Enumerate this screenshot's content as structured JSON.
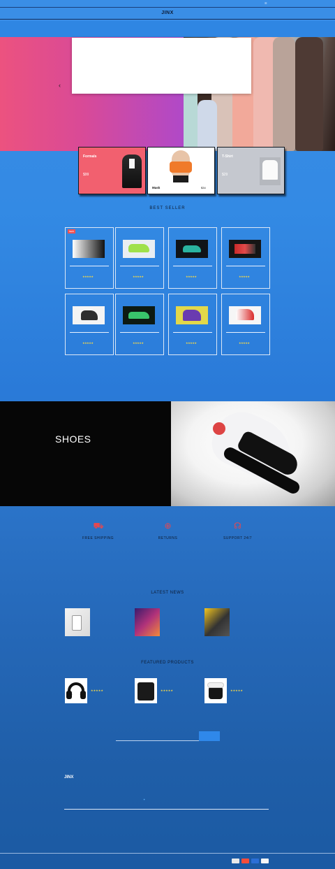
{
  "topbar": {
    "left": "",
    "links": [
      "",
      ""
    ]
  },
  "brand": {
    "logo": "JINX"
  },
  "nav": {
    "items": [
      "",
      "",
      "",
      "",
      "",
      ""
    ]
  },
  "mega_menu": {
    "columns": [
      {
        "heading": "",
        "items": [
          "",
          "",
          "",
          "",
          ""
        ]
      },
      {
        "heading": "",
        "items": [
          "",
          "",
          ""
        ]
      },
      {
        "heading": "",
        "items": [
          "",
          "",
          "",
          "",
          ""
        ]
      },
      {
        "heading": "",
        "items": [
          "",
          ""
        ]
      },
      {
        "heading": "",
        "items": [
          "",
          "",
          ""
        ]
      }
    ]
  },
  "hero": {
    "button": ""
  },
  "categories": [
    {
      "title": "Formals",
      "desc": "",
      "price": "$99",
      "color": "#f2606f"
    },
    {
      "title": "Mask",
      "desc": "",
      "price": "$34",
      "color": "#ffffff"
    },
    {
      "title": "T-Shirt",
      "desc": "",
      "price": "$29",
      "color": "#c5c8cf"
    }
  ],
  "best_seller": {
    "title": "BEST SELLER",
    "tabs": [
      "",
      "",
      "",
      "",
      "",
      "",
      ""
    ],
    "products": [
      {
        "badge": "NEW",
        "stars": "★★★★★",
        "price": "",
        "old": ""
      },
      {
        "badge": "",
        "stars": "★★★★★",
        "price": "",
        "old": ""
      },
      {
        "badge": "",
        "stars": "★★★★★",
        "price": "",
        "old": ""
      },
      {
        "badge": "",
        "stars": "★★★★★",
        "price": "",
        "old": ""
      },
      {
        "badge": "",
        "stars": "★★★★★",
        "price": "",
        "old": ""
      },
      {
        "badge": "",
        "stars": "★★★★★",
        "price": "",
        "old": ""
      },
      {
        "badge": "",
        "stars": "★★★★★",
        "price": "",
        "old": ""
      },
      {
        "badge": "",
        "stars": "★★★★★",
        "price": "",
        "old": ""
      }
    ],
    "load_more": ""
  },
  "shoe_banner": {
    "title": "SHOES",
    "desc": "",
    "button": ""
  },
  "features": [
    {
      "icon": "truck-icon",
      "title": "FREE SHIPPING",
      "desc": ""
    },
    {
      "icon": "dollar-icon",
      "title": "RETURNS",
      "desc": ""
    },
    {
      "icon": "support-icon",
      "title": "SUPPORT 24/7",
      "desc": ""
    }
  ],
  "latest_news": {
    "title": "LATEST NEWS",
    "items": [
      {
        "date": "",
        "title": "",
        "text": ""
      },
      {
        "date": "",
        "title": "",
        "text": ""
      },
      {
        "date": "",
        "title": "",
        "text": ""
      }
    ]
  },
  "featured_products": {
    "title": "FEATURED PRODUCTS",
    "items": [
      {
        "name": "",
        "stars": "★★★★★",
        "price": ""
      },
      {
        "name": "",
        "stars": "★★★★★",
        "price": ""
      },
      {
        "name": "",
        "stars": "★★★★★",
        "price": ""
      }
    ]
  },
  "newsletter": {
    "placeholder": "",
    "button": ""
  },
  "footer": {
    "logo": "JINX",
    "about": "",
    "col2": {
      "heading": "",
      "text": ""
    },
    "col3": {
      "heading": "",
      "text": ""
    },
    "columns": [
      {
        "heading": "",
        "links": [
          "",
          "",
          "",
          ""
        ]
      },
      {
        "heading": "",
        "links": [
          "",
          "",
          "",
          ""
        ]
      },
      {
        "heading": "",
        "links": [
          "",
          "",
          "",
          ""
        ]
      },
      {
        "heading": "",
        "links": [
          "",
          "",
          "",
          ""
        ]
      },
      {
        "heading": "",
        "links": [
          "",
          "",
          "",
          ""
        ]
      },
      {
        "heading": "",
        "links": [
          "",
          "",
          "",
          ""
        ]
      }
    ],
    "copyright": "",
    "payments": [
      "#e9e9e9",
      "#f44d3a",
      "#2b6fd6",
      "#f6f6f6"
    ]
  }
}
